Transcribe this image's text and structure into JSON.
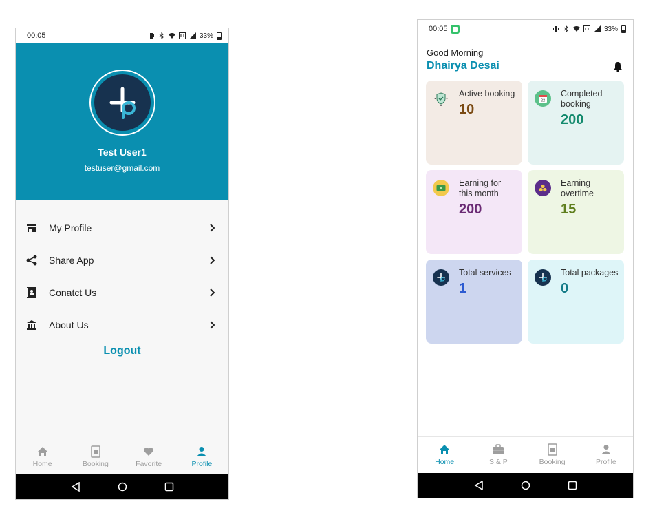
{
  "profile_screen": {
    "status": {
      "time": "00:05",
      "battery": "33%"
    },
    "user": {
      "name": "Test User1",
      "email": "testuser@gmail.com"
    },
    "menu": [
      {
        "icon": "store-icon",
        "label": "My Profile"
      },
      {
        "icon": "share-icon",
        "label": "Share App"
      },
      {
        "icon": "contact-card-icon",
        "label": "Conatct Us"
      },
      {
        "icon": "bank-icon",
        "label": "About Us"
      }
    ],
    "logout_label": "Logout",
    "nav": [
      {
        "icon": "home-icon",
        "label": "Home"
      },
      {
        "icon": "booking-icon",
        "label": "Booking"
      },
      {
        "icon": "heart-icon",
        "label": "Favorite"
      },
      {
        "icon": "person-icon",
        "label": "Profile",
        "active": true
      }
    ]
  },
  "home_screen": {
    "status": {
      "time": "00:05",
      "battery": "33%"
    },
    "greeting": "Good Morning",
    "user_name": "Dhairya Desai",
    "cards": [
      {
        "label": "Active booking",
        "value": "10",
        "bg": "#f3ebe5",
        "value_color": "#7a4a13",
        "icon": "shield-check-icon"
      },
      {
        "label": "Completed booking",
        "value": "200",
        "bg": "#e5f3f2",
        "value_color": "#148a6e",
        "icon": "calendar-icon"
      },
      {
        "label": "Earning for this month",
        "value": "200",
        "bg": "#f4e7f7",
        "value_color": "#6a2a74",
        "icon": "money-icon"
      },
      {
        "label": "Earning overtime",
        "value": "15",
        "bg": "#eef6e4",
        "value_color": "#5f7f1e",
        "icon": "coins-icon"
      },
      {
        "label": "Total services",
        "value": "1",
        "bg": "#cdd6ef",
        "value_color": "#2d5bd1",
        "icon": "app-logo-icon"
      },
      {
        "label": "Total packages",
        "value": "0",
        "bg": "#def5f8",
        "value_color": "#137a87",
        "icon": "app-logo-icon"
      }
    ],
    "nav": [
      {
        "icon": "home-icon",
        "label": "Home",
        "active": true
      },
      {
        "icon": "briefcase-icon",
        "label": "S & P"
      },
      {
        "icon": "booking-icon",
        "label": "Booking"
      },
      {
        "icon": "person-icon",
        "label": "Profile"
      }
    ]
  },
  "colors": {
    "primary": "#0a8fb0",
    "logo_bg": "#17324f"
  }
}
